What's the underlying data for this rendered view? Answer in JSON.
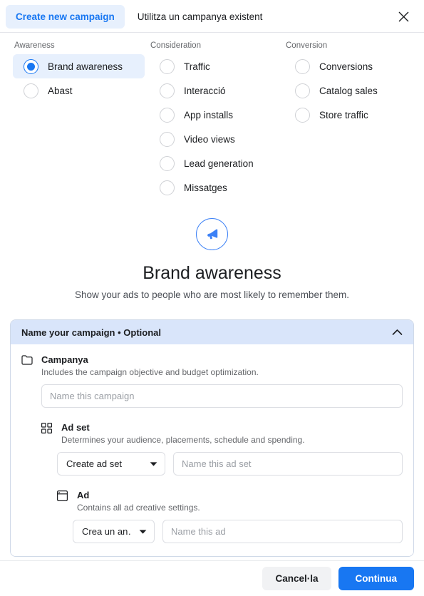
{
  "header": {
    "tab_new_label": "Create new campaign",
    "tab_existing_label": "Utilitza un campanya existent",
    "close_icon": "close-icon"
  },
  "objectives": {
    "columns": [
      {
        "title": "Awareness",
        "options": [
          {
            "label": "Brand awareness",
            "selected": true
          },
          {
            "label": "Abast",
            "selected": false
          }
        ]
      },
      {
        "title": "Consideration",
        "options": [
          {
            "label": "Traffic",
            "selected": false
          },
          {
            "label": "Interacció",
            "selected": false
          },
          {
            "label": "App installs",
            "selected": false
          },
          {
            "label": "Video views",
            "selected": false
          },
          {
            "label": "Lead generation",
            "selected": false
          },
          {
            "label": "Missatges",
            "selected": false
          }
        ]
      },
      {
        "title": "Conversion",
        "options": [
          {
            "label": "Conversions",
            "selected": false
          },
          {
            "label": "Catalog sales",
            "selected": false
          },
          {
            "label": "Store traffic",
            "selected": false
          }
        ]
      }
    ]
  },
  "hero": {
    "icon": "megaphone-icon",
    "title": "Brand awareness",
    "subtitle": "Show your ads to people who are most likely to remember them."
  },
  "name_card": {
    "header_title": "Name your campaign • Optional",
    "collapse_icon": "chevron-up-icon",
    "campaign": {
      "icon": "folder-icon",
      "title": "Campanya",
      "description": "Includes the campaign objective and budget optimization.",
      "input_placeholder": "Name this campaign",
      "input_value": ""
    },
    "ad_set": {
      "icon": "grid-icon",
      "title": "Ad set",
      "description": "Determines your audience, placements, schedule and spending.",
      "select_value": "Create ad set",
      "input_placeholder": "Name this ad set",
      "input_value": ""
    },
    "ad": {
      "icon": "window-icon",
      "title": "Ad",
      "description": "Contains all ad creative settings.",
      "select_value": "Crea un an…",
      "input_placeholder": "Name this ad",
      "input_value": ""
    }
  },
  "footer": {
    "cancel_label": "Cancel·la",
    "continue_label": "Continua"
  },
  "colors": {
    "accent": "#1877f2",
    "tab_highlight": "#e7f0fd",
    "card_header": "#d9e5fa",
    "muted_text": "#65676b"
  }
}
